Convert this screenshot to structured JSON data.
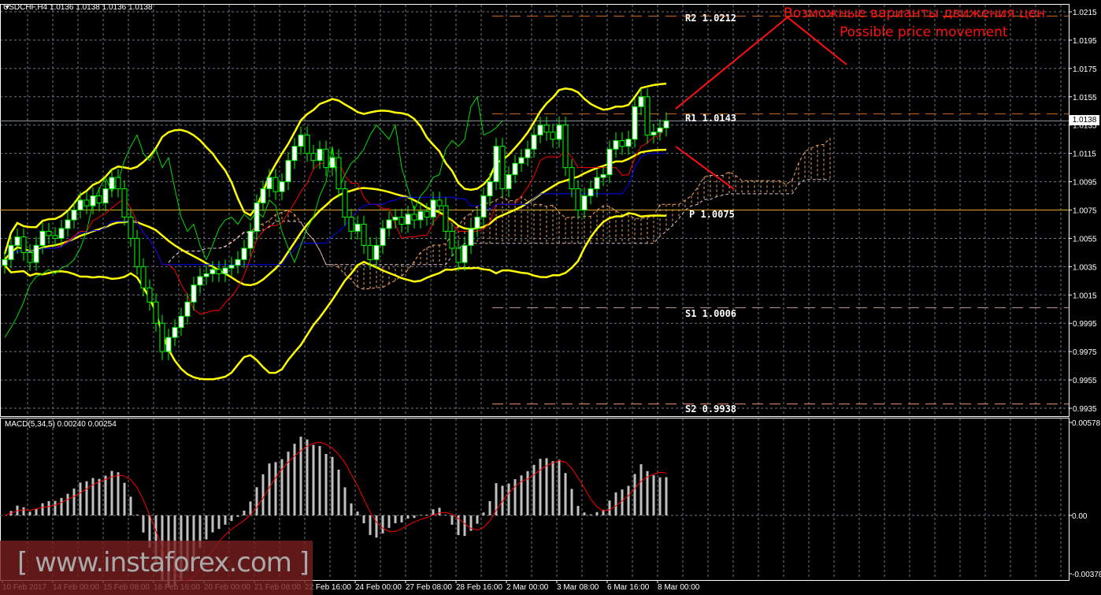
{
  "window": {
    "title": "USDCHF,H4  1.0136 1.0138 1.0136 1.0138"
  },
  "current_price": "1.0138",
  "levels": [
    {
      "name": "R2",
      "label": "R2 1.0212",
      "value": 1.0212,
      "color": "#d2691e"
    },
    {
      "name": "R1",
      "label": "R1 1.0143",
      "value": 1.0143,
      "color": "#d2691e"
    },
    {
      "name": "P",
      "label": "P 1.0075",
      "value": 1.0075,
      "color": "#daa520"
    },
    {
      "name": "S1",
      "label": "S1 1.0006",
      "value": 1.0006,
      "color": "#bc8f8f"
    },
    {
      "name": "S2",
      "label": "S2 0.9938",
      "value": 0.9938,
      "color": "#e9967a"
    }
  ],
  "annotation": {
    "ru": "Возможные варианты движения цен",
    "en": "Possible price movement",
    "color": "#ff1010"
  },
  "macd": {
    "title": "MACD(5,34,5) 0.00240 0.00254",
    "axis": [
      "0.00578",
      "0.00",
      "-0.00378"
    ]
  },
  "watermark": "[ www.instaforex.com ]",
  "colors": {
    "bollinger": "#ffff00",
    "tenkan": "#ff0000",
    "kijun": "#0000ff",
    "chikou": "#00dd00",
    "cloud": "#f4a460",
    "grid": "#6b7785",
    "candle_up": "#ffffff",
    "wick": "#00ff00",
    "macd_hist": "#c0c0c0",
    "macd_signal": "#ff0000"
  },
  "chart_data": {
    "type": "candlestick",
    "symbol": "USDCHF",
    "timeframe": "H4",
    "price_ticks": [
      "1.0215",
      "1.0195",
      "1.0175",
      "1.0155",
      "1.0135",
      "1.0115",
      "1.0095",
      "1.0075",
      "1.0055",
      "1.0035",
      "1.0015",
      "0.9995",
      "0.9975",
      "0.9955",
      "0.9935"
    ],
    "ylim": [
      0.9935,
      1.0215
    ],
    "time_ticks": [
      "10 Feb 2017",
      "14 Feb 00:00",
      "15 Feb 08:00",
      "16 Feb 16:00",
      "20 Feb 00:00",
      "21 Feb 08:00",
      "22 Feb 16:00",
      "24 Feb 00:00",
      "27 Feb 08:00",
      "28 Feb 16:00",
      "2 Mar 00:00",
      "3 Mar 08:00",
      "6 Mar 16:00",
      "8 Mar 00:00"
    ],
    "close": [
      1.004,
      1.005,
      1.0056,
      1.0045,
      1.0038,
      1.005,
      1.006,
      1.0057,
      1.0055,
      1.0062,
      1.0068,
      1.0075,
      1.0082,
      1.0078,
      1.0085,
      1.008,
      1.009,
      1.0098,
      1.009,
      1.007,
      1.0055,
      1.0035,
      1.002,
      1.001,
      0.9995,
      0.9975,
      0.9985,
      0.9992,
      1.0,
      1.001,
      1.0022,
      1.0028,
      1.003,
      1.0033,
      1.003,
      1.0034,
      1.0036,
      1.004,
      1.0048,
      1.006,
      1.008,
      1.009,
      1.0098,
      1.0088,
      1.0095,
      1.011,
      1.012,
      1.0128,
      1.0115,
      1.011,
      1.0118,
      1.0105,
      1.0112,
      1.009,
      1.007,
      1.006,
      1.0065,
      1.005,
      1.004,
      1.005,
      1.0062,
      1.0068,
      1.007,
      1.0065,
      1.0072,
      1.0068,
      1.0074,
      1.007,
      1.0082,
      1.0078,
      1.006,
      1.0048,
      1.0038,
      1.005,
      1.0062,
      1.007,
      1.0085,
      1.0095,
      1.012,
      1.009,
      1.01,
      1.0108,
      1.0112,
      1.0118,
      1.0128,
      1.0135,
      1.013,
      1.0125,
      1.0135,
      1.0105,
      1.009,
      1.0075,
      1.0085,
      1.009,
      1.0098,
      1.01,
      1.0118,
      1.0124,
      1.012,
      1.0125,
      1.0148,
      1.0155,
      1.0128,
      1.013,
      1.0133,
      1.0138
    ]
  }
}
